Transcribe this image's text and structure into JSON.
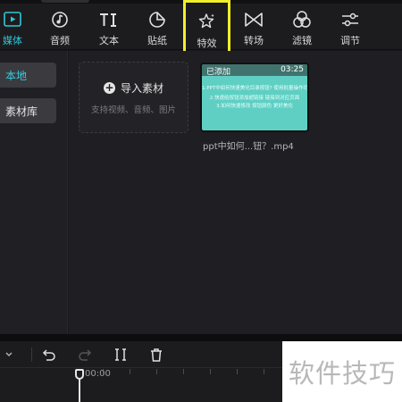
{
  "toolbar": {
    "tabs": [
      {
        "label": "媒体",
        "icon": "media-icon",
        "active": true
      },
      {
        "label": "音频",
        "icon": "audio-icon"
      },
      {
        "label": "文本",
        "icon": "text-icon"
      },
      {
        "label": "贴纸",
        "icon": "sticker-icon"
      },
      {
        "label": "特效",
        "icon": "effects-icon",
        "highlighted": true
      },
      {
        "label": "转场",
        "icon": "transition-icon"
      },
      {
        "label": "滤镜",
        "icon": "filter-icon"
      },
      {
        "label": "调节",
        "icon": "adjust-icon"
      }
    ]
  },
  "sidebar": {
    "items": [
      {
        "label": "本地",
        "active": true
      },
      {
        "label": "素材库"
      }
    ]
  },
  "media": {
    "import_label": "导入素材",
    "import_hint": "支持视频、音频、图片",
    "clip": {
      "badge": "已添加",
      "duration": "03:25",
      "lines": [
        "1.PPT中如何快速美化目录按钮? 使用批量操作功能",
        "2.快速给按钮添加超链接 链接到对应页面",
        "3.如何快速修改 按钮颜色 更好美化"
      ],
      "name": "ppt中如何...钮？.mp4"
    }
  },
  "timeline": {
    "time": "00:00"
  },
  "watermark": "软件技巧",
  "colors": {
    "accent": "#2ec8d8",
    "highlight": "#f0ef2a",
    "clip_bg": "#5fcfc4"
  }
}
